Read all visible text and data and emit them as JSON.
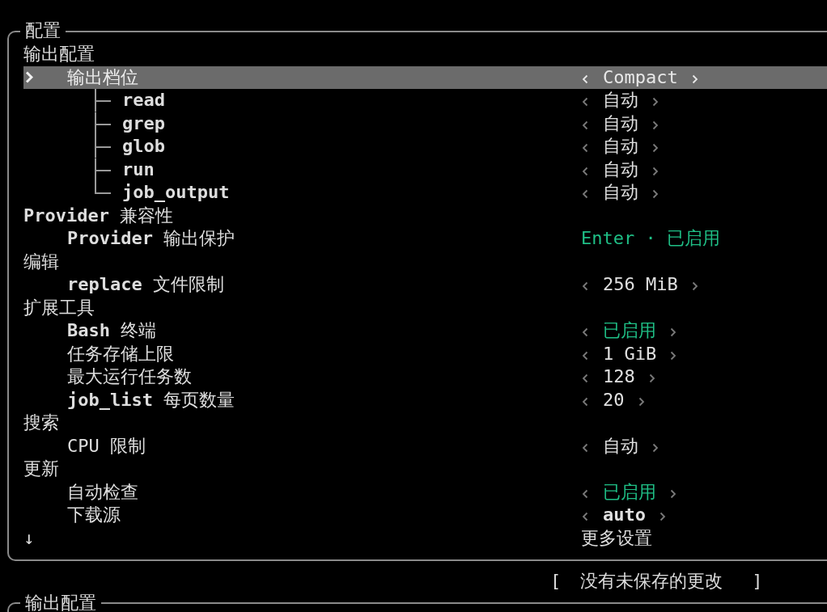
{
  "panel": {
    "title": "配置",
    "sections": [
      {
        "heading": "输出配置",
        "items": [
          {
            "label": "输出档位",
            "selected": true,
            "value": {
              "kind": "choice",
              "text": "Compact"
            },
            "children": [
              {
                "label": "read",
                "selected": false,
                "value": {
                  "kind": "choice",
                  "text": "自动"
                }
              },
              {
                "label": "grep",
                "selected": false,
                "value": {
                  "kind": "choice",
                  "text": "自动"
                }
              },
              {
                "label": "glob",
                "selected": false,
                "value": {
                  "kind": "choice",
                  "text": "自动"
                }
              },
              {
                "label": "run",
                "selected": false,
                "value": {
                  "kind": "choice",
                  "text": "自动"
                }
              },
              {
                "label": "job_output",
                "selected": false,
                "value": {
                  "kind": "choice",
                  "text": "自动"
                }
              }
            ]
          }
        ]
      },
      {
        "heading": "**Provider** 兼容性",
        "items": [
          {
            "label": "**Provider** 输出保护",
            "selected": false,
            "value": {
              "kind": "action",
              "text": "Enter · 已启用",
              "on": true
            }
          }
        ]
      },
      {
        "heading": "编辑",
        "items": [
          {
            "label": "**replace** 文件限制",
            "selected": false,
            "value": {
              "kind": "choice",
              "text": "256 MiB"
            }
          }
        ]
      },
      {
        "heading": "扩展工具",
        "items": [
          {
            "label": "**Bash** 终端",
            "selected": false,
            "value": {
              "kind": "toggle",
              "text": "已启用",
              "on": true
            }
          },
          {
            "label": "任务存储上限",
            "selected": false,
            "value": {
              "kind": "choice",
              "text": "1 GiB"
            }
          },
          {
            "label": "最大运行任务数",
            "selected": false,
            "value": {
              "kind": "choice",
              "text": "128"
            }
          },
          {
            "label": "**job_list** 每页数量",
            "selected": false,
            "value": {
              "kind": "choice",
              "text": "20"
            }
          }
        ]
      },
      {
        "heading": "搜索",
        "items": [
          {
            "label": "CPU 限制",
            "selected": false,
            "value": {
              "kind": "choice",
              "text": "自动"
            }
          }
        ]
      },
      {
        "heading": "更新",
        "items": [
          {
            "label": "自动检查",
            "selected": false,
            "value": {
              "kind": "toggle",
              "text": "已启用",
              "on": true
            }
          },
          {
            "label": "下载源",
            "selected": false,
            "value": {
              "kind": "choice",
              "text": "auto",
              "bold": true
            }
          }
        ]
      }
    ],
    "more": {
      "indicator": "↓",
      "label": "更多设置"
    }
  },
  "status": {
    "open": "[",
    "text": "没有未保存的更改",
    "close": "]"
  },
  "next_panel": {
    "title": "输出配置"
  }
}
